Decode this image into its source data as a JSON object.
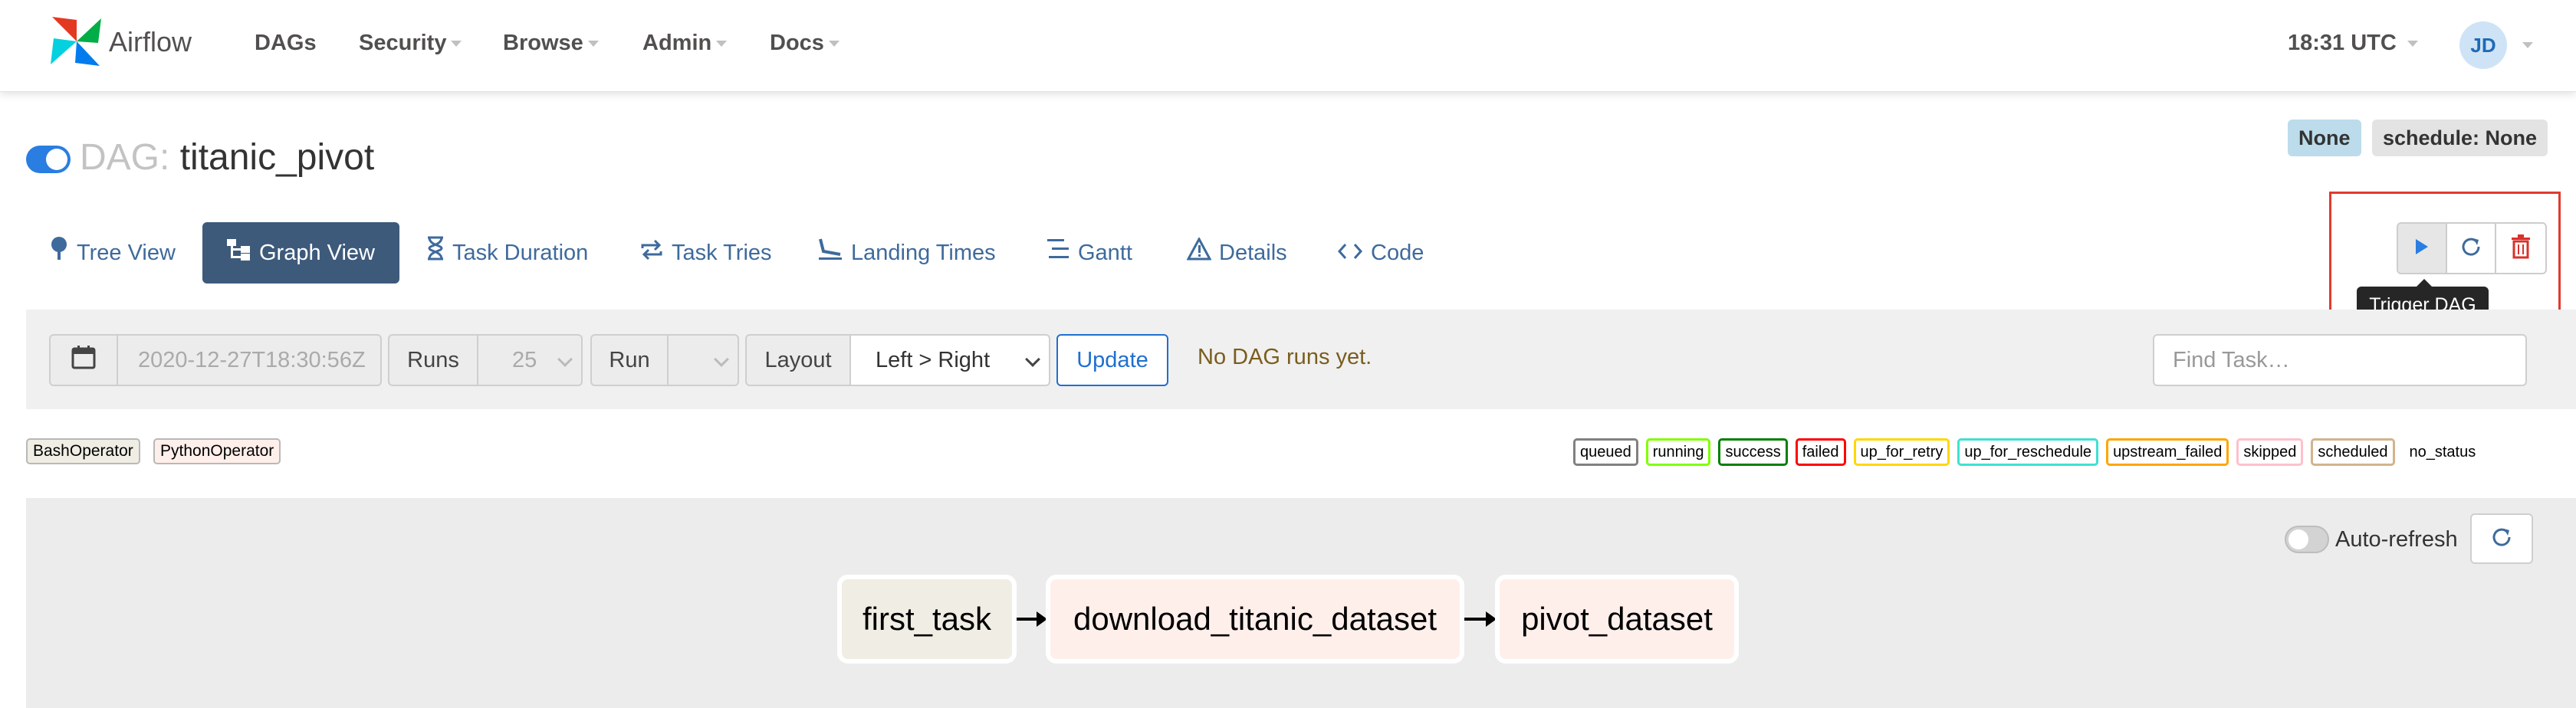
{
  "navbar": {
    "brand": "Airflow",
    "items": [
      {
        "label": "DAGs",
        "caret": false
      },
      {
        "label": "Security",
        "caret": true
      },
      {
        "label": "Browse",
        "caret": true
      },
      {
        "label": "Admin",
        "caret": true
      },
      {
        "label": "Docs",
        "caret": true
      }
    ],
    "time": "18:31 UTC",
    "user_initials": "JD"
  },
  "dag": {
    "prefix": "DAG:",
    "id": "titanic_pivot",
    "paused_toggle_on": true,
    "badges": [
      "None",
      "schedule: None"
    ]
  },
  "tabs": [
    {
      "label": "Tree View",
      "icon": "tree-icon",
      "active": false
    },
    {
      "label": "Graph View",
      "icon": "graph-icon",
      "active": true
    },
    {
      "label": "Task Duration",
      "icon": "hourglass-icon",
      "active": false
    },
    {
      "label": "Task Tries",
      "icon": "retry-arrows-icon",
      "active": false
    },
    {
      "label": "Landing Times",
      "icon": "plane-landing-icon",
      "active": false
    },
    {
      "label": "Gantt",
      "icon": "gantt-icon",
      "active": false
    },
    {
      "label": "Details",
      "icon": "warning-triangle-icon",
      "active": false
    },
    {
      "label": "Code",
      "icon": "code-icon",
      "active": false
    }
  ],
  "actions": {
    "trigger_icon": "play-icon",
    "refresh_icon": "refresh-icon",
    "delete_icon": "trash-icon",
    "tooltip": "Trigger DAG"
  },
  "controls": {
    "base_date": "2020-12-27T18:30:56Z",
    "runs_label": "Runs",
    "runs_value": "25",
    "run_label": "Run",
    "run_value": "",
    "layout_label": "Layout",
    "layout_value": "Left > Right",
    "update_label": "Update",
    "no_runs_message": "No DAG runs yet.",
    "find_task_placeholder": "Find Task…"
  },
  "operators": [
    "BashOperator",
    "PythonOperator"
  ],
  "statuses": [
    {
      "label": "queued",
      "color": "#808080"
    },
    {
      "label": "running",
      "color": "#7fff00"
    },
    {
      "label": "success",
      "color": "#008000"
    },
    {
      "label": "failed",
      "color": "#ff0000"
    },
    {
      "label": "up_for_retry",
      "color": "#ffd700"
    },
    {
      "label": "up_for_reschedule",
      "color": "#40e0d0"
    },
    {
      "label": "upstream_failed",
      "color": "#ffa500"
    },
    {
      "label": "skipped",
      "color": "#ffc0cb"
    },
    {
      "label": "scheduled",
      "color": "#d2b48c"
    },
    {
      "label": "no_status",
      "color": ""
    }
  ],
  "graph": {
    "auto_refresh_label": "Auto-refresh",
    "auto_refresh_on": false,
    "nodes": [
      "first_task",
      "download_titanic_dataset",
      "pivot_dataset"
    ]
  },
  "colors": {
    "accent": "#2a7de1",
    "active_tab": "#3d5a7b",
    "highlight_box": "#e03b2e",
    "trash": "#d9322b"
  }
}
